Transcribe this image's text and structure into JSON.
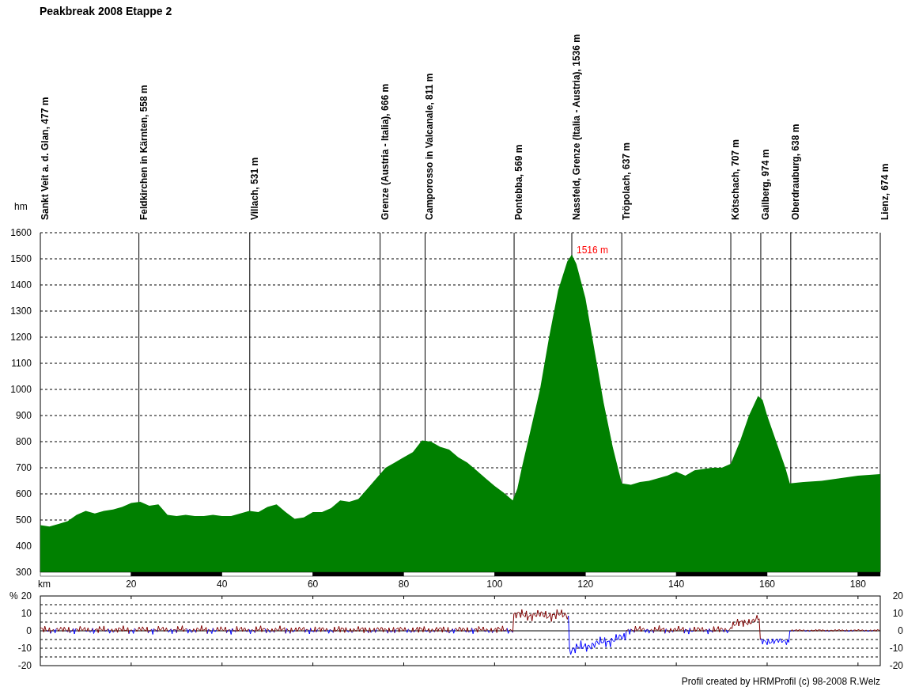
{
  "title": "Peakbreak 2008 Etappe 2",
  "elevation": {
    "chart_data": {
      "type": "area",
      "ylabel": "hm",
      "xlabel": "km",
      "ylim": [
        300,
        1600
      ],
      "xlim": [
        0,
        184.9
      ],
      "yticks": [
        300,
        400,
        500,
        600,
        700,
        800,
        900,
        1000,
        1100,
        1200,
        1300,
        1400,
        1500,
        1600
      ],
      "xticks": [
        20,
        40,
        60,
        80,
        100,
        120,
        140,
        160,
        180
      ],
      "x": [
        0,
        2,
        4,
        6,
        8,
        10,
        12,
        14,
        16,
        18,
        20,
        22,
        24,
        26,
        28,
        30,
        32,
        34,
        36,
        38,
        40,
        42,
        44,
        46,
        48,
        50,
        52,
        54,
        56,
        58,
        60,
        62,
        64,
        66,
        68,
        70,
        72,
        74,
        76,
        78,
        80,
        82,
        84,
        86,
        88,
        90,
        92,
        94,
        96,
        98,
        100,
        102,
        104,
        105,
        106,
        108,
        110,
        112,
        114,
        116,
        117,
        118,
        120,
        122,
        124,
        126,
        128,
        130,
        132,
        134,
        136,
        138,
        140,
        142,
        144,
        146,
        148,
        150,
        152,
        154,
        156,
        158,
        159,
        160,
        162,
        164,
        165,
        168,
        172,
        176,
        180,
        184.9
      ],
      "series": [
        {
          "color": "#008000",
          "values": [
            480,
            475,
            485,
            495,
            520,
            535,
            525,
            535,
            540,
            550,
            565,
            570,
            555,
            560,
            520,
            515,
            520,
            515,
            515,
            520,
            515,
            515,
            525,
            535,
            530,
            550,
            560,
            530,
            505,
            510,
            530,
            530,
            545,
            575,
            570,
            580,
            620,
            660,
            700,
            720,
            740,
            760,
            805,
            800,
            780,
            770,
            740,
            720,
            690,
            660,
            630,
            605,
            575,
            620,
            700,
            850,
            1000,
            1200,
            1380,
            1490,
            1516,
            1480,
            1350,
            1150,
            950,
            780,
            640,
            635,
            645,
            650,
            660,
            670,
            685,
            670,
            690,
            695,
            700,
            700,
            715,
            800,
            900,
            975,
            960,
            900,
            800,
            700,
            640,
            645,
            650,
            660,
            670,
            676
          ]
        }
      ],
      "grid": true,
      "annotations": [
        {
          "x": 117,
          "y": 1516,
          "text": "1516 m"
        }
      ],
      "ref_lines": [
        {
          "axis": "x",
          "value": 0,
          "label": "Sankt Veit a. d. Glan, 477 m"
        },
        {
          "axis": "x",
          "value": 21.7,
          "label": "Feldkirchen in Kärnten, 558 m"
        },
        {
          "axis": "x",
          "value": 46.1,
          "label": "Villach, 531 m"
        },
        {
          "axis": "x",
          "value": 74.8,
          "label": "Grenze (Austria - Italia), 666 m"
        },
        {
          "axis": "x",
          "value": 84.7,
          "label": "Camporosso in Valcanale, 811 m"
        },
        {
          "axis": "x",
          "value": 104.3,
          "label": "Pontebba, 569 m"
        },
        {
          "axis": "x",
          "value": 117,
          "label": "Nassfeld, Grenze (Italia - Austria), 1536 m"
        },
        {
          "axis": "x",
          "value": 128,
          "label": "Tröpolach, 637 m"
        },
        {
          "axis": "x",
          "value": 152,
          "label": "Kötschach, 707 m"
        },
        {
          "axis": "x",
          "value": 158.6,
          "label": "Gailberg, 974 m"
        },
        {
          "axis": "x",
          "value": 165.2,
          "label": "Oberdrauburg, 638 m"
        },
        {
          "axis": "x",
          "value": 184.9,
          "label": "Lienz, 674 m"
        }
      ]
    }
  },
  "gradient": {
    "unit": "%",
    "left_ticks": [
      "20",
      "10",
      "0",
      "-10",
      "-20"
    ],
    "right_ticks": [
      "20",
      "10",
      "0",
      "-10",
      "-20"
    ]
  },
  "footer": "Profil created by HRMProfil (c) 98-2008 R.Welz"
}
